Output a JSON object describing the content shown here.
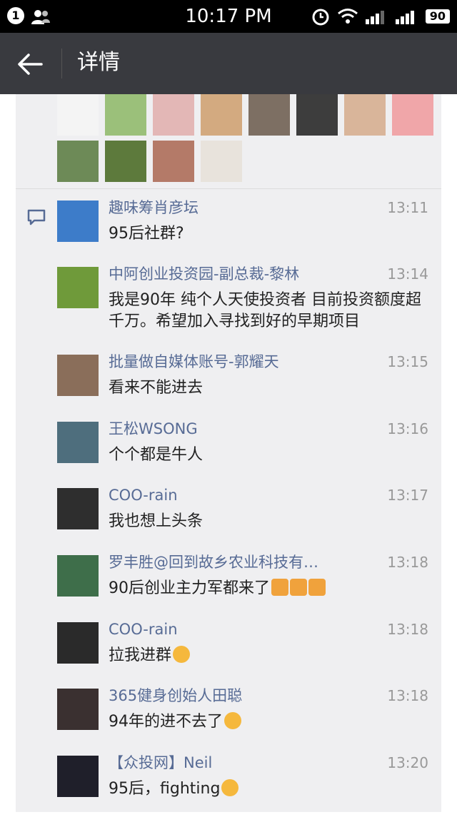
{
  "status_bar": {
    "notification_count": "1",
    "time": "10:17 PM",
    "battery": "90"
  },
  "header": {
    "title": "详情"
  },
  "likes": {
    "avatars": [
      {
        "name": "like-1",
        "color": "#f4f4f4"
      },
      {
        "name": "like-2",
        "color": "#9bc07a"
      },
      {
        "name": "like-3",
        "color": "#e3b7b6"
      },
      {
        "name": "like-4",
        "color": "#d3aa80"
      },
      {
        "name": "like-5",
        "color": "#7d6f63"
      },
      {
        "name": "like-6",
        "color": "#3d3d3d"
      },
      {
        "name": "like-7",
        "color": "#d9b59a"
      },
      {
        "name": "like-8",
        "color": "#f0a6a9"
      },
      {
        "name": "like-9",
        "color": "#6d8a57"
      },
      {
        "name": "like-10",
        "color": "#5d7a3c"
      },
      {
        "name": "like-11",
        "color": "#b47a68"
      },
      {
        "name": "like-12",
        "color": "#e8e3dc"
      }
    ]
  },
  "comments": [
    {
      "name": "趣味筹肖彦坛",
      "time": "13:11",
      "text": "95后社群?",
      "avatar": "#3d7cc9",
      "emoji": ""
    },
    {
      "name": "中阿创业投资园-副总裁-黎林",
      "time": "13:14",
      "text": "我是90年 纯个人天使投资者 目前投资额度超千万。希望加入寻找到好的早期项目",
      "avatar": "#6f9a3a",
      "emoji": ""
    },
    {
      "name": "批量做自媒体账号-郭耀天",
      "time": "13:15",
      "text": "看来不能进去",
      "avatar": "#8a6e5a",
      "emoji": ""
    },
    {
      "name": "王松WSONG",
      "time": "13:16",
      "text": "个个都是牛人",
      "avatar": "#4e6e7d",
      "emoji": ""
    },
    {
      "name": "COO-rain",
      "time": "13:17",
      "text": "我也想上头条",
      "avatar": "#2e2e2e",
      "emoji": ""
    },
    {
      "name": "罗丰胜@回到故乡农业科技有…",
      "time": "13:18",
      "text": "90后创业主力军都来了",
      "avatar": "#3e6e4a",
      "emoji": "pray"
    },
    {
      "name": "COO-rain",
      "time": "13:18",
      "text": "拉我进群",
      "avatar": "#2a2a2a",
      "emoji": "think"
    },
    {
      "name": "365健身创始人田聪",
      "time": "13:18",
      "text": "94年的进不去了",
      "avatar": "#3a3030",
      "emoji": "think"
    },
    {
      "name": "【众投网】Neil",
      "time": "13:20",
      "text": "95后，fighting",
      "avatar": "#1f1f2a",
      "emoji": "muscle"
    }
  ],
  "colors": {
    "name_link": "#576b95",
    "header_bg": "#393a3f",
    "panel_bg": "#efeff1"
  }
}
